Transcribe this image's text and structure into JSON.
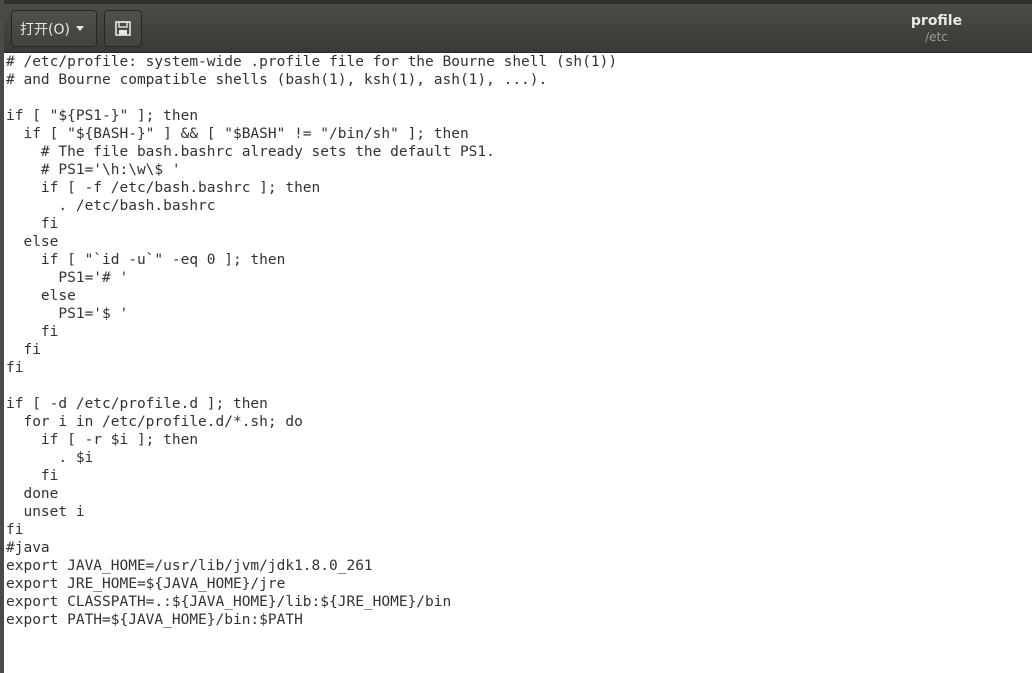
{
  "headerbar": {
    "open_label": "打开(O)",
    "title": "profile",
    "subtitle": "/etc"
  },
  "editor": {
    "lines": [
      "# /etc/profile: system-wide .profile file for the Bourne shell (sh(1))",
      "# and Bourne compatible shells (bash(1), ksh(1), ash(1), ...).",
      "",
      "if [ \"${PS1-}\" ]; then",
      "  if [ \"${BASH-}\" ] && [ \"$BASH\" != \"/bin/sh\" ]; then",
      "    # The file bash.bashrc already sets the default PS1.",
      "    # PS1='\\h:\\w\\$ '",
      "    if [ -f /etc/bash.bashrc ]; then",
      "      . /etc/bash.bashrc",
      "    fi",
      "  else",
      "    if [ \"`id -u`\" -eq 0 ]; then",
      "      PS1='# '",
      "    else",
      "      PS1='$ '",
      "    fi",
      "  fi",
      "fi",
      "",
      "if [ -d /etc/profile.d ]; then",
      "  for i in /etc/profile.d/*.sh; do",
      "    if [ -r $i ]; then",
      "      . $i",
      "    fi",
      "  done",
      "  unset i",
      "fi",
      "#java",
      "export JAVA_HOME=/usr/lib/jvm/jdk1.8.0_261",
      "export JRE_HOME=${JAVA_HOME}/jre",
      "export CLASSPATH=.:${JAVA_HOME}/lib:${JRE_HOME}/bin",
      "export PATH=${JAVA_HOME}/bin:$PATH"
    ]
  },
  "icons": {
    "open_dropdown": "chevron-down-icon",
    "save": "save-document-icon"
  }
}
